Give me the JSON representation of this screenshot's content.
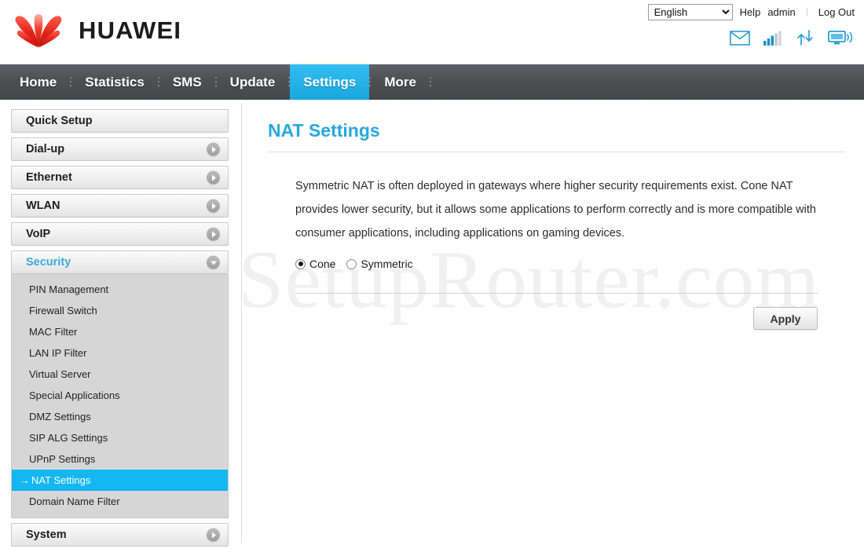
{
  "header": {
    "brand_name": "HUAWEI",
    "logo_icon": "huawei-flower-logo",
    "language": {
      "selected": "English",
      "options": [
        "English"
      ]
    },
    "help_label": "Help",
    "user_label": "admin",
    "logout_label": "Log Out",
    "status_icons": [
      {
        "name": "envelope-icon",
        "title": "Messages"
      },
      {
        "name": "signal-bars-icon",
        "title": "Signal",
        "bars_filled": 3,
        "bars_total": 5
      },
      {
        "name": "up-down-arrows-icon",
        "title": "Data traffic"
      },
      {
        "name": "device-monitor-icon",
        "title": "Connected device"
      }
    ]
  },
  "nav": {
    "items": [
      {
        "label": "Home",
        "active": false
      },
      {
        "label": "Statistics",
        "active": false
      },
      {
        "label": "SMS",
        "active": false
      },
      {
        "label": "Update",
        "active": false
      },
      {
        "label": "Settings",
        "active": true
      },
      {
        "label": "More",
        "active": false
      }
    ],
    "active_color": "#22b2e8",
    "bar_color": "#4c5053"
  },
  "sidebar": {
    "sections": [
      {
        "label": "Quick Setup",
        "state": "plain",
        "chevron": null
      },
      {
        "label": "Dial-up",
        "state": "collapsed",
        "chevron": "chevron-right-icon"
      },
      {
        "label": "Ethernet",
        "state": "collapsed",
        "chevron": "chevron-right-icon"
      },
      {
        "label": "WLAN",
        "state": "collapsed",
        "chevron": "chevron-right-icon"
      },
      {
        "label": "VoIP",
        "state": "collapsed",
        "chevron": "chevron-right-icon"
      },
      {
        "label": "Security",
        "state": "expanded",
        "chevron": "chevron-down-icon"
      }
    ],
    "security_items": [
      {
        "label": "PIN Management",
        "active": false
      },
      {
        "label": "Firewall Switch",
        "active": false
      },
      {
        "label": "MAC Filter",
        "active": false
      },
      {
        "label": "LAN IP Filter",
        "active": false
      },
      {
        "label": "Virtual Server",
        "active": false
      },
      {
        "label": "Special Applications",
        "active": false
      },
      {
        "label": "DMZ Settings",
        "active": false
      },
      {
        "label": "SIP ALG Settings",
        "active": false
      },
      {
        "label": "UPnP Settings",
        "active": false
      },
      {
        "label": "NAT Settings",
        "active": true,
        "arrow": "→"
      },
      {
        "label": "Domain Name Filter",
        "active": false
      }
    ],
    "footer_section": {
      "label": "System",
      "state": "collapsed",
      "chevron": "chevron-right-icon"
    },
    "active_item_color": "#15b7f0",
    "expanded_label_color": "#3ba8d8"
  },
  "main": {
    "title": "NAT Settings",
    "title_color": "#28a8dd",
    "description": "Symmetric NAT is often deployed in gateways where higher security requirements exist. Cone NAT provides lower security, but it allows some applications to perform correctly and is more compatible with consumer applications, including applications on gaming devices.",
    "nat_mode": {
      "selected": "Cone",
      "options": [
        {
          "label": "Cone",
          "checked": true
        },
        {
          "label": "Symmetric",
          "checked": false
        }
      ]
    },
    "apply_label": "Apply",
    "watermark": "SetupRouter.com"
  }
}
